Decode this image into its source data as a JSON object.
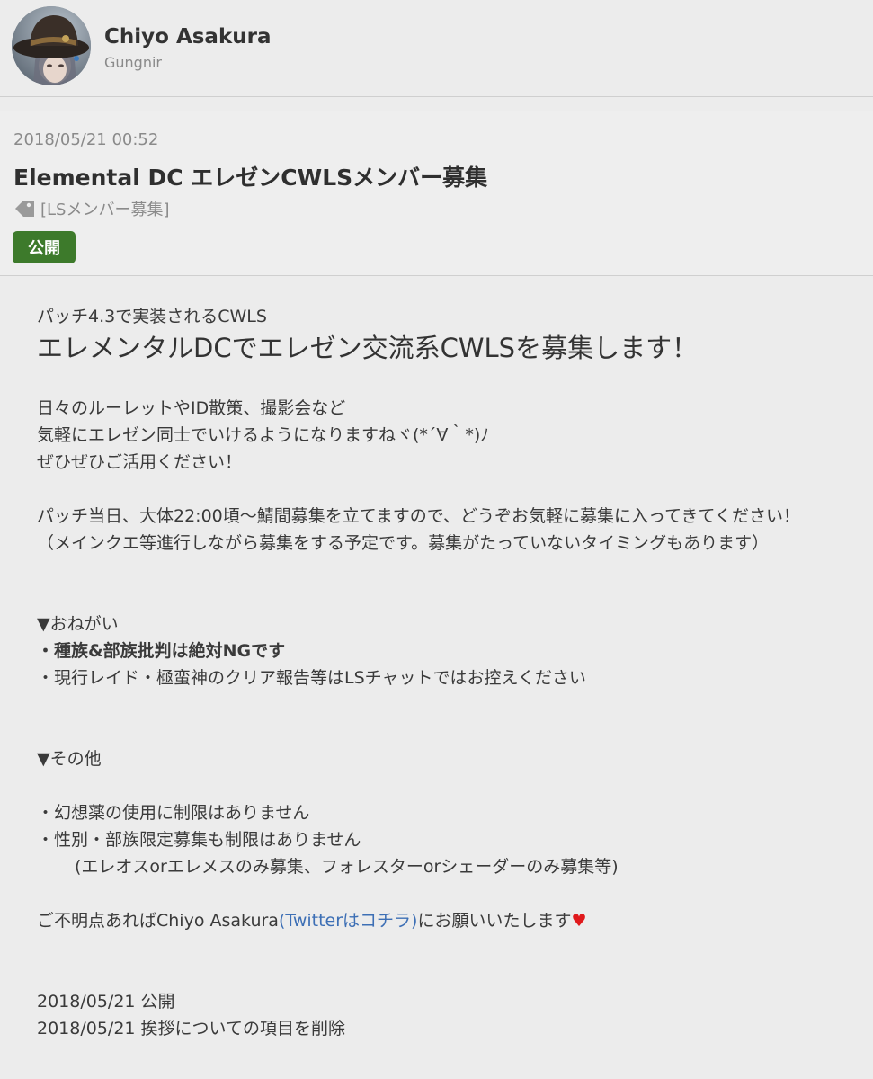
{
  "author": {
    "name": "Chiyo Asakura",
    "world": "Gungnir",
    "avatar_icon": "character-portrait-avatar"
  },
  "entry": {
    "date": "2018/05/21 00:52",
    "title": "Elemental DC エレゼンCWLSメンバー募集",
    "tag_icon": "tag-icon",
    "tag": "[LSメンバー募集]",
    "visibility": "公開",
    "visibility_color": "#3d7a2b"
  },
  "body": {
    "intro": "パッチ4.3で実装されるCWLS",
    "headline": "エレメンタルDCでエレゼン交流系CWLSを募集します！",
    "para1": [
      "日々のルーレットやID散策、撮影会など",
      "気軽にエレゼン同士でいけるようになりますねヾ(*´∀｀*)ﾉ",
      "ぜひぜひご活用ください！"
    ],
    "para2": [
      "パッチ当日、大体22:00頃～鯖間募集を立てますので、どうぞお気軽に募集に入ってきてください！",
      "（メインクエ等進行しながら募集をする予定です。募集がたっていないタイミングもあります）"
    ],
    "rules_heading": "▼おねがい",
    "rules": [
      "・種族&部族批判は絶対NGです",
      "・現行レイド・極蛮神のクリア報告等はLSチャットではお控えください"
    ],
    "other_heading": "▼その他",
    "other": [
      "・幻想薬の使用に制限はありません",
      "・性別・部族限定募集も制限はありません",
      "(エレオスorエレメスのみ募集、フォレスターorシェーダーのみ募集等)"
    ],
    "contact_prefix": "ご不明点あればChiyo Asakura",
    "contact_link": "(Twitterはコチラ)",
    "contact_suffix": "にお願いいたします",
    "heart": "♥",
    "link_color": "#3d6fb5",
    "history": [
      "2018/05/21 公開",
      "2018/05/21 挨拶についての項目を削除"
    ]
  }
}
